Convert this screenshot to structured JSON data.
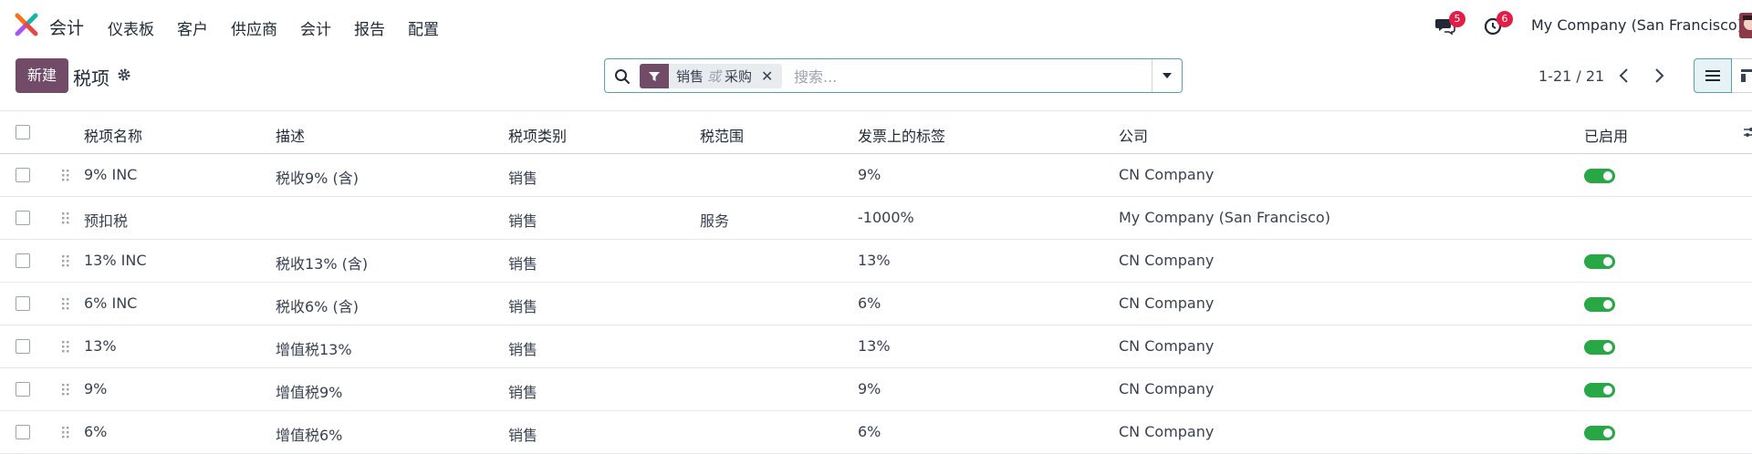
{
  "navbar": {
    "app_name": "会计",
    "menu": [
      "仪表板",
      "客户",
      "供应商",
      "会计",
      "报告",
      "配置"
    ],
    "messages_badge": "5",
    "activities_badge": "6",
    "company": "My Company (San Francisco)"
  },
  "control": {
    "new_label": "新建",
    "title": "税项",
    "facet_a": "销售",
    "facet_or": "或",
    "facet_b": "采购",
    "search_placeholder": "搜索...",
    "pager": "1-21 / 21"
  },
  "table": {
    "headers": [
      "税项名称",
      "描述",
      "税项类别",
      "税范围",
      "发票上的标签",
      "公司",
      "已启用"
    ],
    "rows": [
      {
        "name": "9% INC",
        "desc": "税收9% (含)",
        "type": "销售",
        "scope": "",
        "label": "9%",
        "company": "CN Company",
        "active": true
      },
      {
        "name": "预扣税",
        "desc": "",
        "type": "销售",
        "scope": "服务",
        "label": "-1000%",
        "company": "My Company (San Francisco)",
        "active": false
      },
      {
        "name": "13% INC",
        "desc": "税收13% (含)",
        "type": "销售",
        "scope": "",
        "label": "13%",
        "company": "CN Company",
        "active": true
      },
      {
        "name": "6% INC",
        "desc": "税收6% (含)",
        "type": "销售",
        "scope": "",
        "label": "6%",
        "company": "CN Company",
        "active": true
      },
      {
        "name": "13%",
        "desc": "增值税13%",
        "type": "销售",
        "scope": "",
        "label": "13%",
        "company": "CN Company",
        "active": true
      },
      {
        "name": "9%",
        "desc": "增值税9%",
        "type": "销售",
        "scope": "",
        "label": "9%",
        "company": "CN Company",
        "active": true
      },
      {
        "name": "6%",
        "desc": "增值税6%",
        "type": "销售",
        "scope": "",
        "label": "6%",
        "company": "CN Company",
        "active": true
      }
    ]
  },
  "colors": {
    "brand": "#714b67",
    "toggle_on": "#28a745",
    "badge": "#e11d48",
    "focus": "#5aa0a8"
  }
}
